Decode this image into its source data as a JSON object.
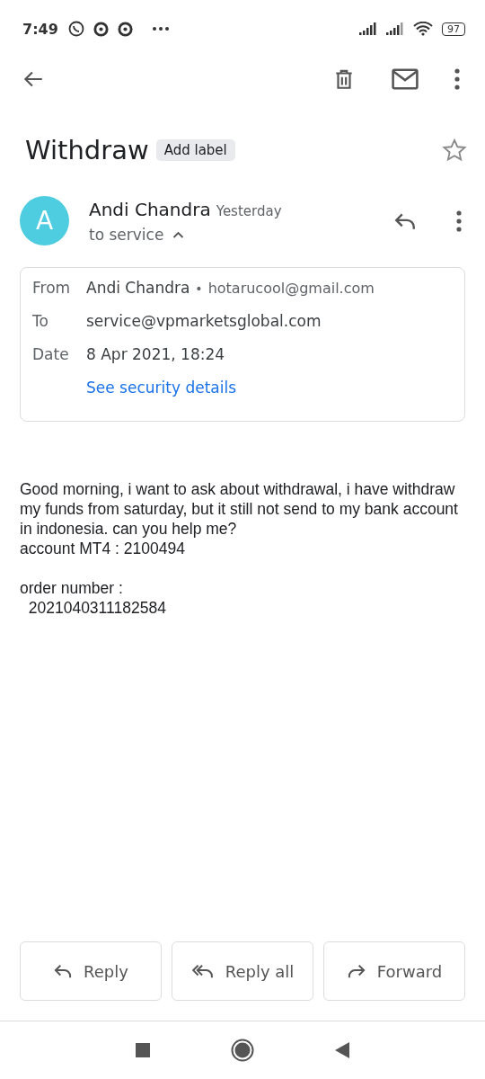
{
  "status_bar": {
    "time": "7:49",
    "battery": "97"
  },
  "subject": {
    "title": "Withdraw",
    "label_button": "Add label",
    "starred": false
  },
  "sender": {
    "avatar_letter": "A",
    "name": "Andi Chandra",
    "time": "Yesterday",
    "recipient": "to service",
    "expanded": true
  },
  "details": [
    {
      "label": "From",
      "value": "Andi Chandra",
      "separator": "•",
      "extra": "hotarucool@gmail.com"
    },
    {
      "label": "To",
      "value": "service@vpmarketsglobal.com"
    },
    {
      "label": "Date",
      "value": "8 Apr 2021, 18:24"
    }
  ],
  "security_link": "See security details",
  "body": "Good morning, i want to ask about withdrawal, i have withdraw my funds from saturday, but it still not send to my bank account in indonesia. can you help me?\naccount MT4 : 2100494\n\norder number :\n  2021040311182584",
  "actions": [
    {
      "kind": "reply",
      "label": "Reply"
    },
    {
      "kind": "reply_all",
      "label": "Reply all"
    },
    {
      "kind": "forward",
      "label": "Forward"
    }
  ]
}
